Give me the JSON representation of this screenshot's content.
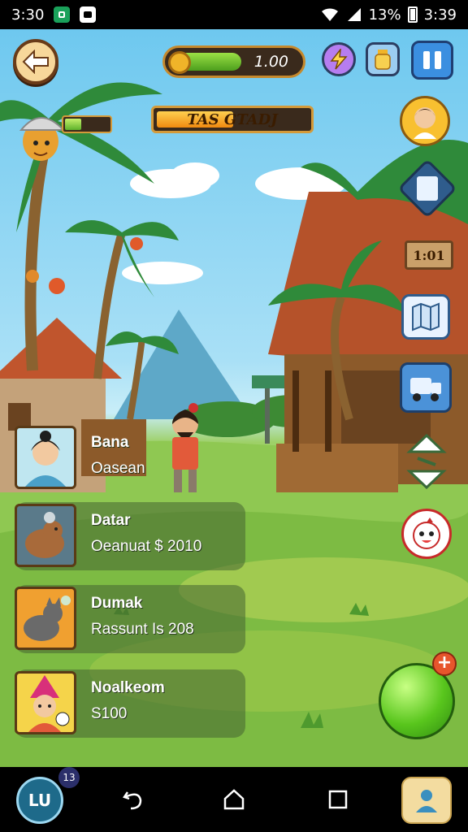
{
  "status_bar": {
    "time_left": "3:30",
    "battery": "13%",
    "time_right": "3:39"
  },
  "hud": {
    "coins_value": "1.00",
    "coin_fill_fraction": 0.48,
    "progress_label": "TAS GTADJ",
    "progress_fill_fraction": 0.5,
    "player_bar_fill_fraction": 0.35
  },
  "side_icons": {
    "sign_text": "1:01"
  },
  "characters": [
    {
      "name": "Bana",
      "detail": "Oasean"
    },
    {
      "name": "Datar",
      "detail": "Oeanuat $ 2010"
    },
    {
      "name": "Dumak",
      "detail": "Rassunt Is 208"
    },
    {
      "name": "Noalkeom",
      "detail": "S100"
    }
  ],
  "nav": {
    "app_label": "LU",
    "app_badge": "13"
  },
  "colors": {
    "accent_green": "#59c61d",
    "wood_brown": "#6a3b18",
    "ui_blue": "#3b8fe0",
    "gold": "#f0b429"
  }
}
